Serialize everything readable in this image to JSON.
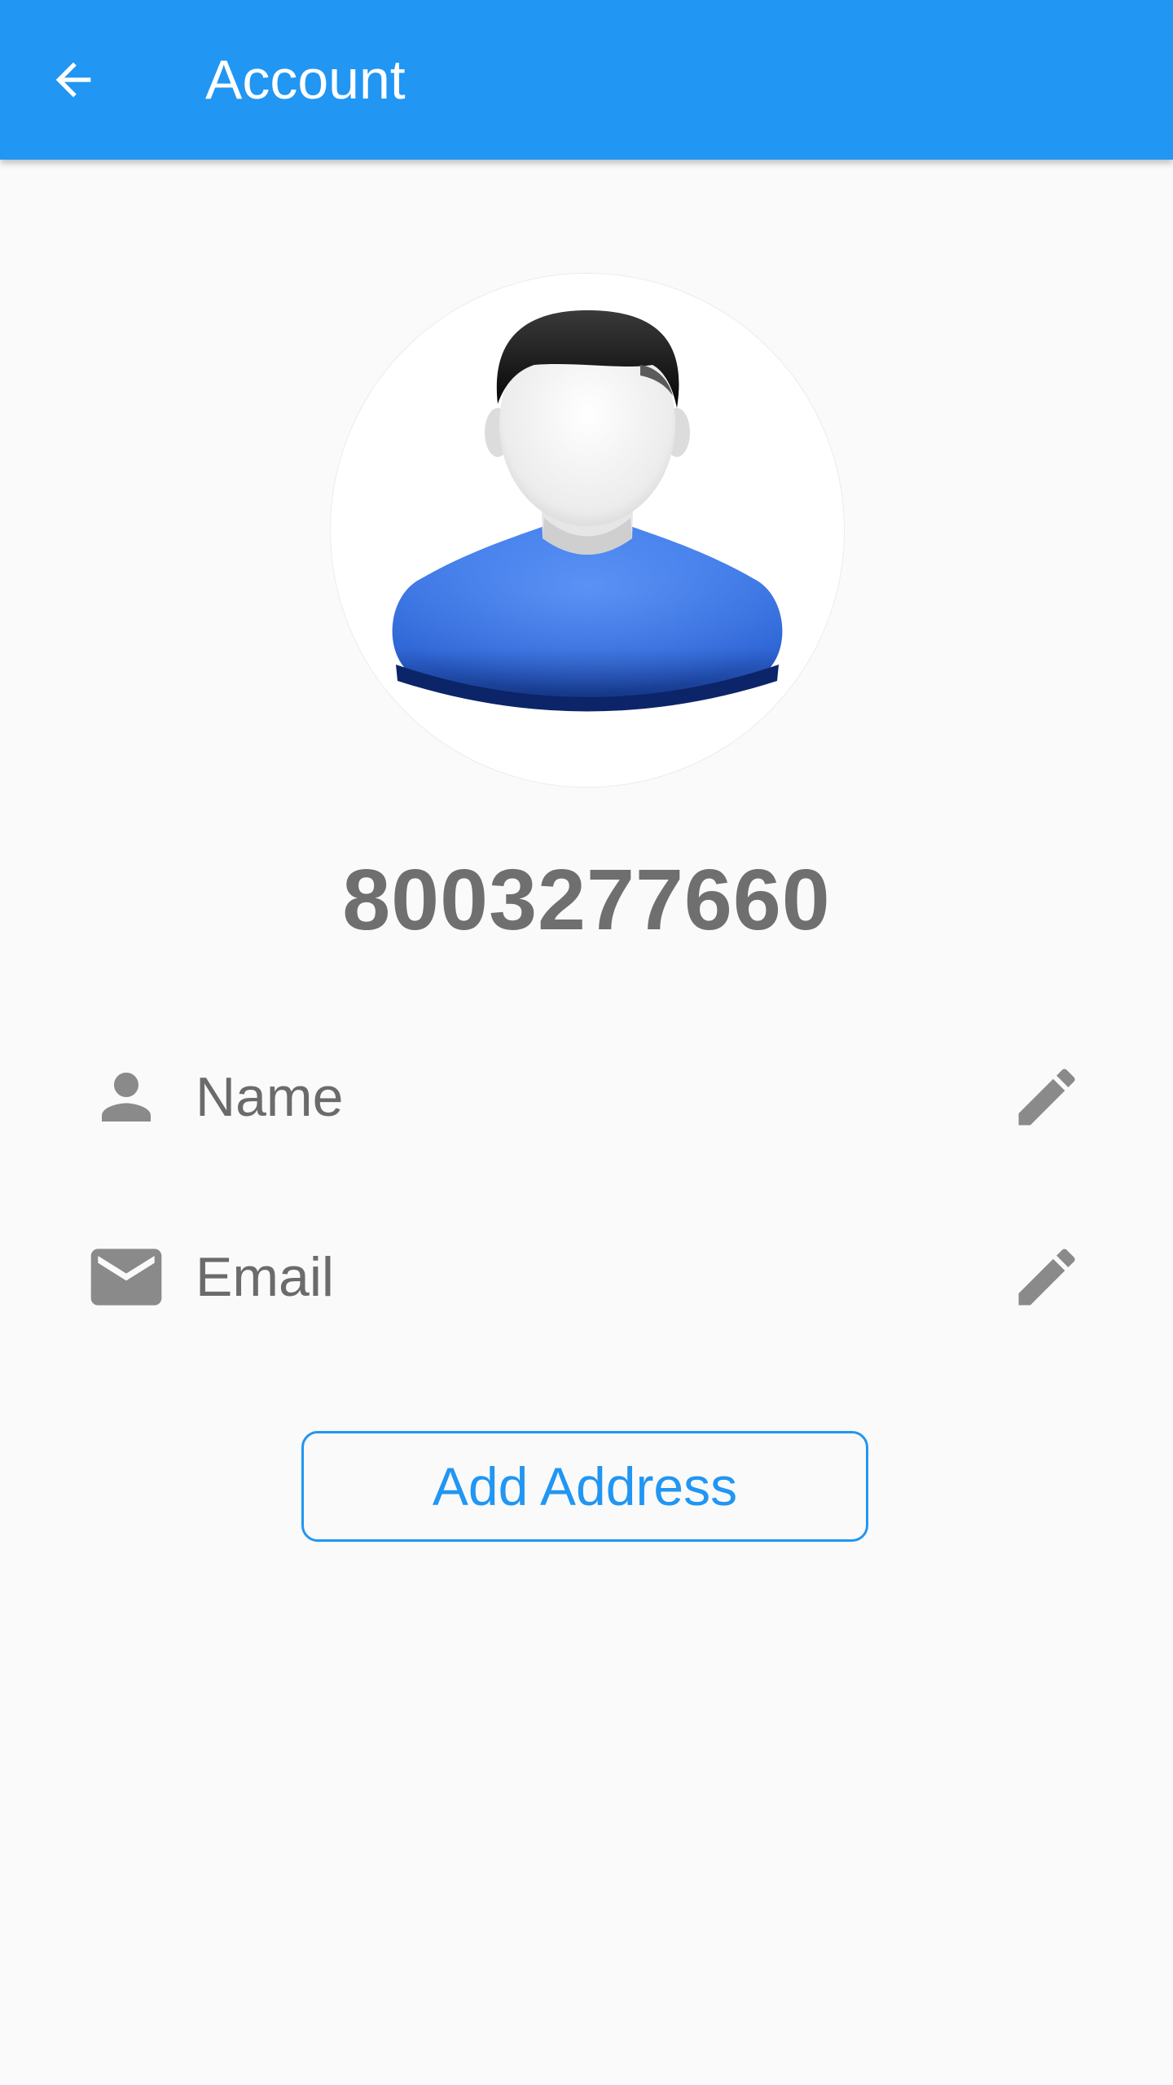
{
  "appbar": {
    "title": "Account",
    "back_icon": "arrow-back-icon",
    "color": "#2196f3"
  },
  "profile": {
    "avatar_icon": "user-avatar-icon",
    "phone": "8003277660"
  },
  "fields": [
    {
      "label": "Name",
      "icon": "person-icon",
      "edit_icon": "pencil-icon"
    },
    {
      "label": "Email",
      "icon": "mail-icon",
      "edit_icon": "pencil-icon"
    }
  ],
  "actions": {
    "add_address_label": "Add Address"
  },
  "colors": {
    "accent": "#2196f3",
    "icon_gray": "#8a8a8a",
    "text_gray": "#6b6b6b",
    "background": "#fafafa"
  }
}
